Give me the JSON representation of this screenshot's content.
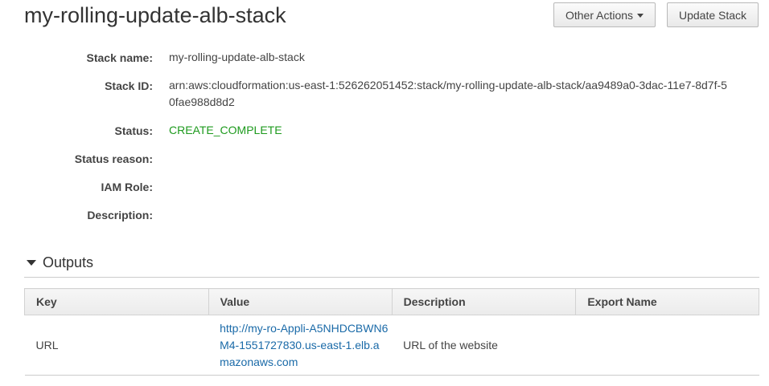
{
  "page": {
    "title": "my-rolling-update-alb-stack"
  },
  "toolbar": {
    "other_actions_label": "Other Actions",
    "update_stack_label": "Update Stack"
  },
  "details": {
    "stack_name_label": "Stack name:",
    "stack_name": "my-rolling-update-alb-stack",
    "stack_id_label": "Stack ID:",
    "stack_id": "arn:aws:cloudformation:us-east-1:526262051452:stack/my-rolling-update-alb-stack/aa9489a0-3dac-11e7-8d7f-50fae988d8d2",
    "status_label": "Status:",
    "status": "CREATE_COMPLETE",
    "status_reason_label": "Status reason:",
    "status_reason": "",
    "iam_role_label": "IAM Role:",
    "iam_role": "",
    "description_label": "Description:",
    "description": ""
  },
  "outputs": {
    "title": "Outputs",
    "columns": [
      "Key",
      "Value",
      "Description",
      "Export Name"
    ],
    "rows": [
      {
        "key": "URL",
        "value": "http://my-ro-Appli-A5NHDCBWN6M4-1551727830.us-east-1.elb.amazonaws.com",
        "description": "URL of the website",
        "export_name": ""
      }
    ]
  },
  "colors": {
    "status_green": "#1d9a1d",
    "link_blue": "#1a6aa8"
  }
}
